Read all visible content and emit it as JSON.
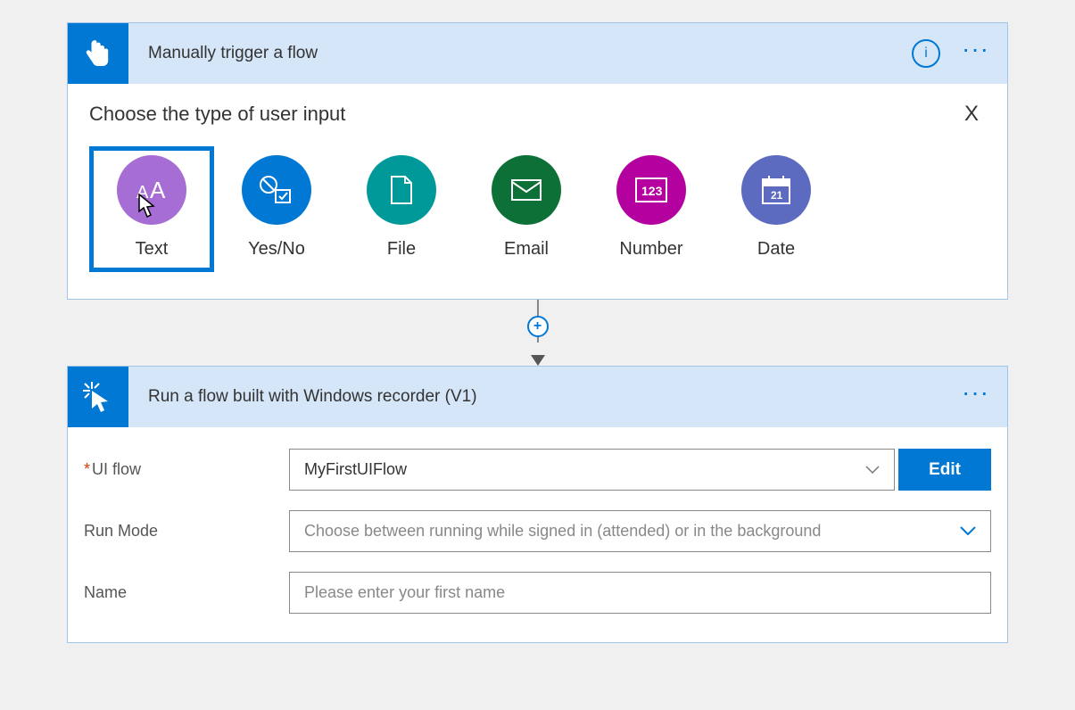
{
  "trigger": {
    "title": "Manually trigger a flow",
    "section_title": "Choose the type of user input",
    "input_types": [
      {
        "label": "Text",
        "color": "purple",
        "selected": true
      },
      {
        "label": "Yes/No",
        "color": "blue",
        "selected": false
      },
      {
        "label": "File",
        "color": "teal",
        "selected": false
      },
      {
        "label": "Email",
        "color": "green",
        "selected": false
      },
      {
        "label": "Number",
        "color": "magenta",
        "selected": false
      },
      {
        "label": "Date",
        "color": "indigo",
        "selected": false
      }
    ]
  },
  "action": {
    "title": "Run a flow built with Windows recorder (V1)",
    "fields": {
      "ui_flow": {
        "label": "UI flow",
        "required": true,
        "value": "MyFirstUIFlow",
        "edit_label": "Edit"
      },
      "run_mode": {
        "label": "Run Mode",
        "placeholder": "Choose between running while signed in (attended) or in the background"
      },
      "name": {
        "label": "Name",
        "placeholder": "Please enter your first name"
      }
    }
  }
}
